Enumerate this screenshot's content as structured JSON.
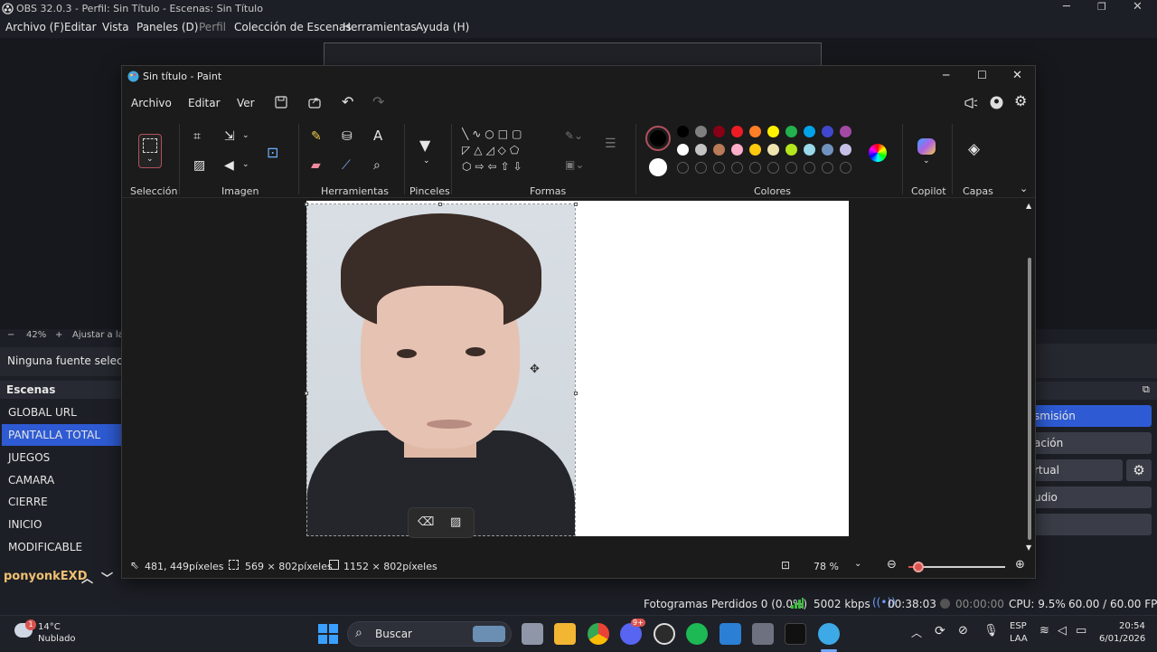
{
  "obs": {
    "title": "OBS 32.0.3 - Perfil: Sin Título - Escenas: Sin Título",
    "menu": [
      "Archivo (F)",
      "Editar",
      "Vista",
      "Paneles (D)",
      "Perfil",
      "Colección de Escenas",
      "Herramientas",
      "Ayuda (H)"
    ],
    "zoom": {
      "minus": "−",
      "value": "42%",
      "plus": "+",
      "fit": "Ajustar a la v"
    },
    "source_none": "Ninguna fuente seleccio",
    "scenes": {
      "header": "Escenas",
      "items": [
        "GLOBAL URL",
        "PANTALLA TOTAL",
        "JUEGOS",
        "CAMARA",
        "CIERRE",
        "INICIO",
        "MODIFICABLE"
      ],
      "active_index": 1
    },
    "controls": [
      "smisión",
      "ación",
      "rtual",
      "udio"
    ],
    "status": {
      "dropped": "Fotogramas Perdidos 0 (0.0%)",
      "kbps": "5002 kbps",
      "rec_time": "00:38:03",
      "stream_time": "00:00:00",
      "cpu": "CPU: 9.5%",
      "fps": "60.00 / 60.00 FPS"
    },
    "overlay_text": "ponyonkEXD"
  },
  "paint": {
    "title": "Sin título - Paint",
    "menu": [
      "Archivo",
      "Editar",
      "Ver"
    ],
    "ribbon_labels": {
      "selection": "Selección",
      "image": "Imagen",
      "tools": "Herramientas",
      "brushes": "Pinceles",
      "shapes": "Formas",
      "colors": "Colores",
      "copilot": "Copilot",
      "layers": "Capas"
    },
    "status": {
      "cursor": "481, 449píxeles",
      "selection": "569 × 802píxeles",
      "canvas": "1152 × 802píxeles",
      "zoom": "78 %",
      "zoom_fraction": 0.1
    },
    "colors": {
      "primary": "#000000",
      "secondary": "#ffffff",
      "palette_row1": [
        "#000000",
        "#7f7f7f",
        "#880015",
        "#ed1c24",
        "#ff7f27",
        "#fff200",
        "#22b14c",
        "#00a2e8",
        "#3f48cc",
        "#a349a4"
      ],
      "palette_row2": [
        "#ffffff",
        "#c3c3c3",
        "#b97a57",
        "#ffaec9",
        "#ffc90e",
        "#efe4b0",
        "#b5e61d",
        "#99d9ea",
        "#7092be",
        "#c8bfe7"
      ]
    }
  },
  "taskbar": {
    "weather_temp": "14°C",
    "weather_desc": "Nublado",
    "weather_badge": "1",
    "search": "Buscar",
    "lang": "ESP",
    "lang2": "LAA",
    "time": "20:54",
    "date": "6/01/2026",
    "discord_badge": "9+"
  }
}
